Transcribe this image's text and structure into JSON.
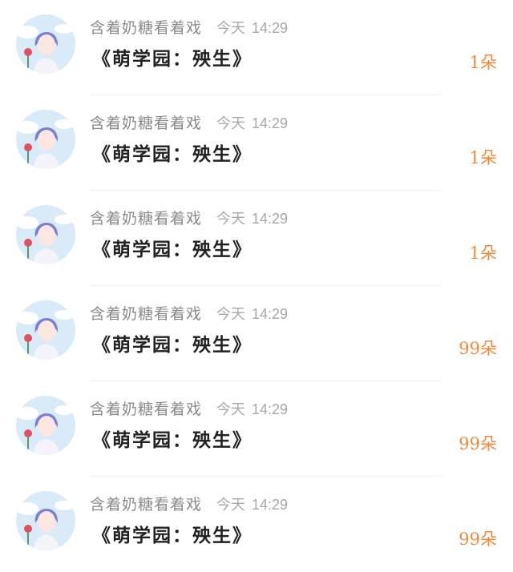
{
  "messages": [
    {
      "user": "含着奶糖看着戏",
      "day": "今天",
      "time": "14:29",
      "work": "《萌学园：殃生》",
      "gift": "1朵",
      "avatar": "anime-avatar-icon"
    },
    {
      "user": "含着奶糖看着戏",
      "day": "今天",
      "time": "14:29",
      "work": "《萌学园：殃生》",
      "gift": "1朵",
      "avatar": "anime-avatar-icon"
    },
    {
      "user": "含着奶糖看着戏",
      "day": "今天",
      "time": "14:29",
      "work": "《萌学园：殃生》",
      "gift": "1朵",
      "avatar": "anime-avatar-icon"
    },
    {
      "user": "含着奶糖看着戏",
      "day": "今天",
      "time": "14:29",
      "work": "《萌学园：殃生》",
      "gift": "99朵",
      "avatar": "anime-avatar-icon"
    },
    {
      "user": "含着奶糖看着戏",
      "day": "今天",
      "time": "14:29",
      "work": "《萌学园：殃生》",
      "gift": "99朵",
      "avatar": "anime-avatar-icon"
    },
    {
      "user": "含着奶糖看着戏",
      "day": "今天",
      "time": "14:29",
      "work": "《萌学园：殃生》",
      "gift": "99朵",
      "avatar": "anime-avatar-icon"
    }
  ],
  "colors": {
    "gift": "#ef8a3c",
    "username": "#8a8a8a",
    "title": "#222222",
    "timestamp": "#a8a8a8"
  }
}
